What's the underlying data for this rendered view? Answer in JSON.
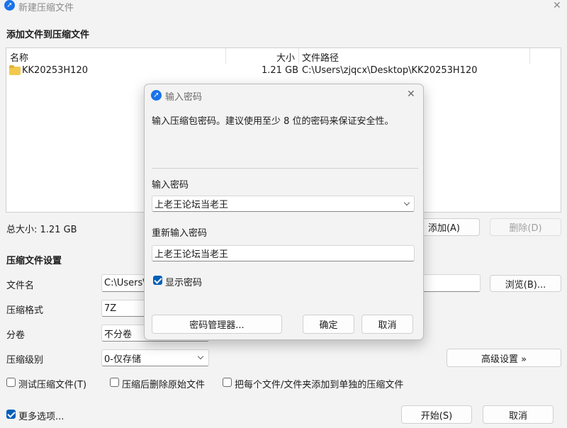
{
  "window": {
    "title": "新建压缩文件",
    "close_glyph": "✕"
  },
  "files_section": {
    "header": "添加文件到压缩文件",
    "columns": {
      "name": "名称",
      "size": "大小",
      "path": "文件路径"
    },
    "rows": [
      {
        "name": "KK20253H120",
        "size": "1.21 GB",
        "path": "C:\\Users\\zjqcx\\Desktop\\KK20253H120"
      }
    ],
    "total_size": "总大小: 1.21 GB",
    "add_label": "添加(A)",
    "delete_label": "删除(D)"
  },
  "settings": {
    "header": "压缩文件设置",
    "filename_label": "文件名",
    "filename_value": "C:\\Users\\",
    "browse_label": "浏览(B)...",
    "format_label": "压缩格式",
    "format_value": "7Z",
    "volume_label": "分卷",
    "volume_value": "不分卷",
    "level_label": "压缩级别",
    "level_value": "0-仅存储",
    "advanced_label": "高级设置 »",
    "test_label": "测试压缩文件(T)",
    "delete_after_label": "压缩后删除原始文件",
    "separate_label": "把每个文件/文件夹添加到单独的压缩文件"
  },
  "footer": {
    "more_options_label": "更多选项...",
    "start_label": "开始(S)",
    "cancel_label": "取消"
  },
  "dialog": {
    "title": "输入密码",
    "close_glyph": "✕",
    "message": "输入压缩包密码。建议使用至少 8 位的密码来保证安全性。",
    "password_label": "输入密码",
    "password_value": "上老王论坛当老王",
    "reenter_label": "重新输入密码",
    "reenter_value": "上老王论坛当老王",
    "show_password_label": "显示密码",
    "manager_label": "密码管理器...",
    "ok_label": "确定",
    "cancel_label": "取消"
  },
  "colors": {
    "accent": "#005fb8",
    "window_bg": "#f3f3f3",
    "app_icon": "#1a73e8",
    "folder": "#f2c94c"
  },
  "icons": {
    "app": "app-icon",
    "folder": "folder-icon"
  }
}
